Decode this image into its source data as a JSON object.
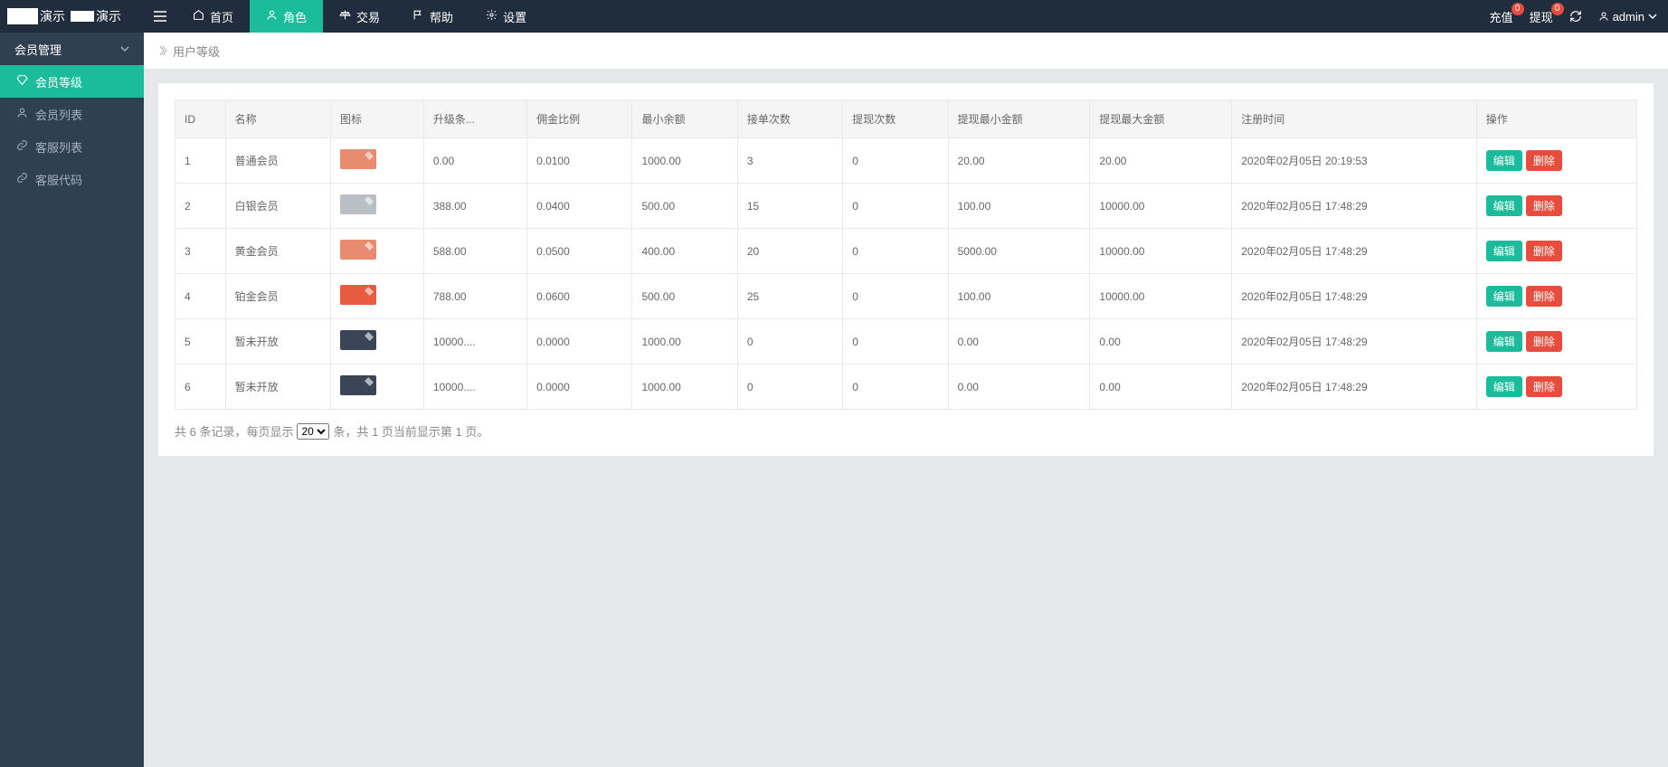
{
  "brand": {
    "text1": "演示",
    "text2": "演示"
  },
  "top_nav": [
    {
      "icon": "home",
      "label": "首页"
    },
    {
      "icon": "user",
      "label": "角色",
      "active": true
    },
    {
      "icon": "scale",
      "label": "交易"
    },
    {
      "icon": "flag",
      "label": "帮助"
    },
    {
      "icon": "gear",
      "label": "设置"
    }
  ],
  "top_right": {
    "recharge": {
      "label": "充值",
      "badge": "0"
    },
    "withdraw": {
      "label": "提现",
      "badge": "0"
    },
    "user": "admin"
  },
  "sidebar": {
    "group": "会员管理",
    "items": [
      {
        "icon": "diamond",
        "label": "会员等级",
        "active": true
      },
      {
        "icon": "user",
        "label": "会员列表"
      },
      {
        "icon": "link",
        "label": "客服列表"
      },
      {
        "icon": "link",
        "label": "客服代码"
      }
    ]
  },
  "breadcrumb": "用户等级",
  "table": {
    "headers": [
      "ID",
      "名称",
      "图标",
      "升级条...",
      "佣金比例",
      "最小余额",
      "接单次数",
      "提现次数",
      "提现最小金额",
      "提现最大金额",
      "注册时间",
      "操作"
    ],
    "rows": [
      {
        "id": "1",
        "name": "普通会员",
        "color": "#e98b6f",
        "upgrade": "0.00",
        "commission": "0.0100",
        "min_bal": "1000.00",
        "orders": "3",
        "withdraws": "0",
        "wmin": "20.00",
        "wmax": "20.00",
        "reg": "2020年02月05日 20:19:53"
      },
      {
        "id": "2",
        "name": "白银会员",
        "color": "#b9bfc4",
        "upgrade": "388.00",
        "commission": "0.0400",
        "min_bal": "500.00",
        "orders": "15",
        "withdraws": "0",
        "wmin": "100.00",
        "wmax": "10000.00",
        "reg": "2020年02月05日 17:48:29"
      },
      {
        "id": "3",
        "name": "黄金会员",
        "color": "#e98b6f",
        "upgrade": "588.00",
        "commission": "0.0500",
        "min_bal": "400.00",
        "orders": "20",
        "withdraws": "0",
        "wmin": "5000.00",
        "wmax": "10000.00",
        "reg": "2020年02月05日 17:48:29"
      },
      {
        "id": "4",
        "name": "铂金会员",
        "color": "#e75b3e",
        "upgrade": "788.00",
        "commission": "0.0600",
        "min_bal": "500.00",
        "orders": "25",
        "withdraws": "0",
        "wmin": "100.00",
        "wmax": "10000.00",
        "reg": "2020年02月05日 17:48:29"
      },
      {
        "id": "5",
        "name": "暂未开放",
        "color": "#3a4657",
        "upgrade": "10000....",
        "commission": "0.0000",
        "min_bal": "1000.00",
        "orders": "0",
        "withdraws": "0",
        "wmin": "0.00",
        "wmax": "0.00",
        "reg": "2020年02月05日 17:48:29"
      },
      {
        "id": "6",
        "name": "暂未开放",
        "color": "#3a4657",
        "upgrade": "10000....",
        "commission": "0.0000",
        "min_bal": "1000.00",
        "orders": "0",
        "withdraws": "0",
        "wmin": "0.00",
        "wmax": "0.00",
        "reg": "2020年02月05日 17:48:29"
      }
    ],
    "actions": {
      "edit": "编辑",
      "delete": "删除"
    }
  },
  "pager": {
    "prefix": "共 6 条记录，每页显示",
    "selected": "20",
    "suffix": "条，共 1 页当前显示第 1 页。"
  }
}
